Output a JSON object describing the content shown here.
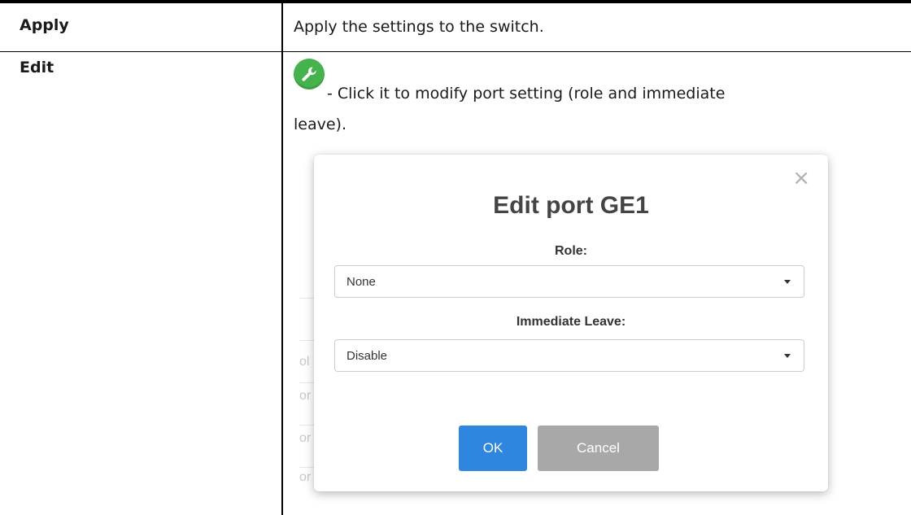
{
  "rows": [
    {
      "term": "Apply",
      "description": "Apply the settings to the switch."
    },
    {
      "term": "Edit",
      "icon": "wrench-icon",
      "description_line1": "- Click it to modify port setting (role and immediate",
      "description_line2": "leave)."
    }
  ],
  "dialog": {
    "title": "Edit port GE1",
    "close_label": "×",
    "role_label": "Role:",
    "role_value": "None",
    "immediate_leave_label": "Immediate Leave:",
    "immediate_leave_value": "Disable",
    "ok_label": "OK",
    "cancel_label": "Cancel"
  },
  "background_partial_text": [
    "ol",
    "or",
    "or",
    "or"
  ],
  "colors": {
    "icon_green": "#45b34b",
    "ok_button": "#2e86de",
    "cancel_button": "#a8a8a8"
  }
}
